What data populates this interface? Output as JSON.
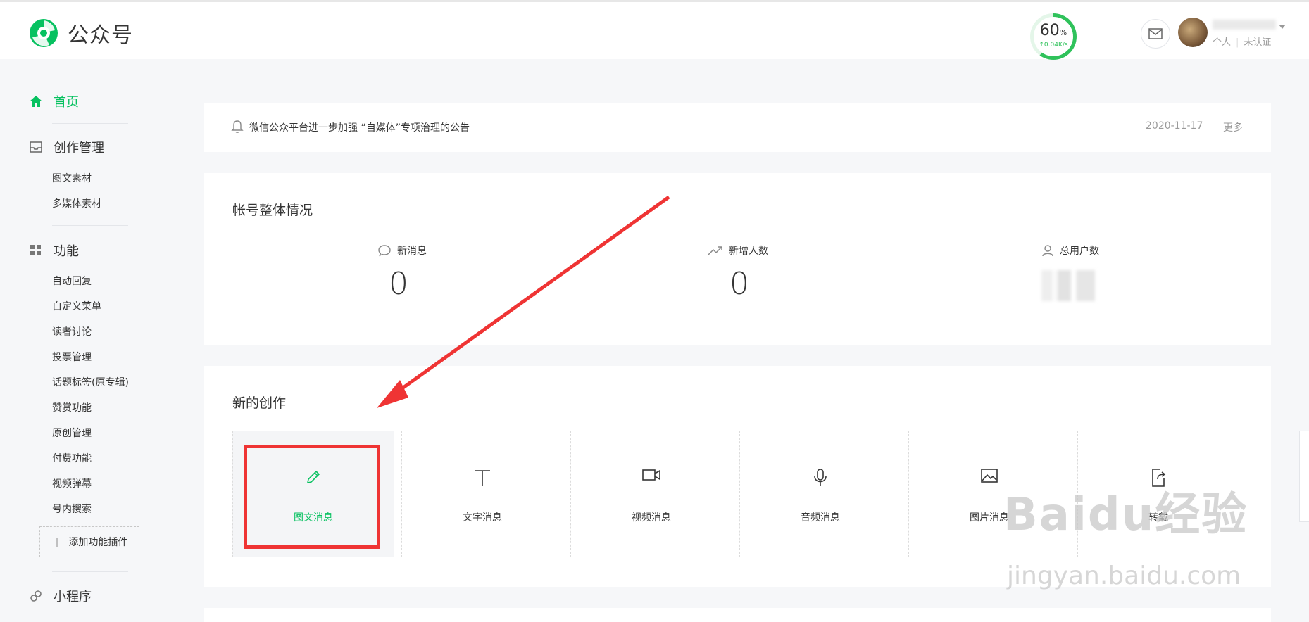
{
  "header": {
    "brand": "公众号",
    "speed_percent": "60",
    "speed_unit": "%",
    "speed_rate": "↑0.04K/s",
    "user_links": [
      "个人",
      "未认证"
    ]
  },
  "sidebar": {
    "home": "首页",
    "creation": "创作管理",
    "creation_items": [
      "图文素材",
      "多媒体素材"
    ],
    "features": "功能",
    "feature_items": [
      "自动回复",
      "自定义菜单",
      "读者讨论",
      "投票管理",
      "话题标签(原专辑)",
      "赞赏功能",
      "原创管理",
      "付费功能",
      "视频弹幕",
      "号内搜索"
    ],
    "add_plugin": "添加功能插件",
    "miniprogram": "小程序"
  },
  "notice": {
    "text": "微信公众平台进一步加强 “自媒体”专项治理的公告",
    "date": "2020-11-17",
    "more": "更多"
  },
  "overview": {
    "title": "帐号整体情况",
    "stats": [
      {
        "label": "新消息",
        "value": "0",
        "icon": "chat-bubble-icon"
      },
      {
        "label": "新增人数",
        "value": "0",
        "icon": "trend-up-icon"
      },
      {
        "label": "总用户数",
        "value": "",
        "icon": "user-icon"
      }
    ]
  },
  "create": {
    "title": "新的创作",
    "tiles": [
      {
        "label": "图文消息",
        "icon": "pencil-icon"
      },
      {
        "label": "文字消息",
        "icon": "text-t-icon"
      },
      {
        "label": "视频消息",
        "icon": "video-camera-icon"
      },
      {
        "label": "音频消息",
        "icon": "microphone-icon"
      },
      {
        "label": "图片消息",
        "icon": "image-icon"
      },
      {
        "label": "转载",
        "icon": "share-doc-icon"
      }
    ]
  },
  "watermark": {
    "main": "Baidu经验",
    "sub": "jingyan.baidu.com"
  },
  "colors": {
    "accent": "#07c160",
    "highlight": "#ef3434"
  }
}
